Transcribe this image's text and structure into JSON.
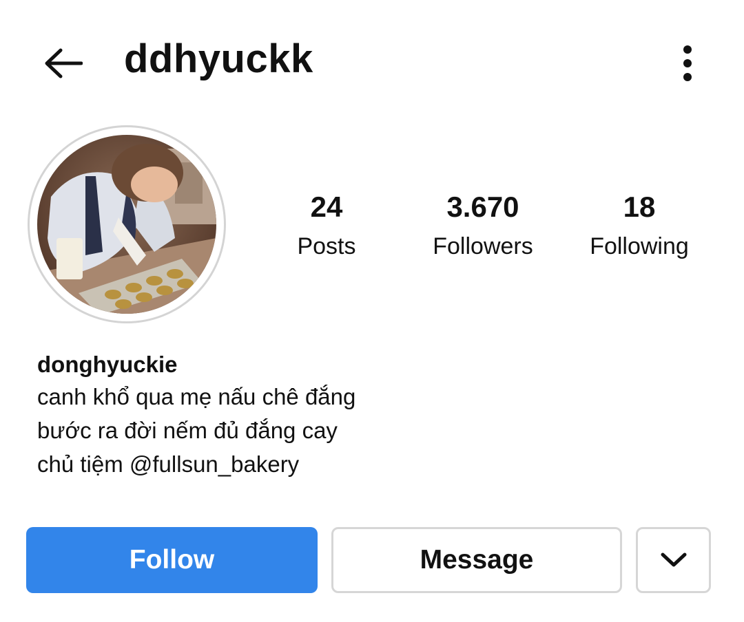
{
  "header": {
    "back_icon": "arrow-left-icon",
    "username": "ddhyuckk",
    "more_icon": "more-vertical-icon"
  },
  "profile": {
    "avatar_description": "profile photo",
    "stats": [
      {
        "value": "24",
        "label": "Posts"
      },
      {
        "value": "3.670",
        "label": "Followers"
      },
      {
        "value": "18",
        "label": "Following"
      }
    ]
  },
  "bio": {
    "name": "donghyuckie",
    "lines": [
      "canh khổ qua mẹ nấu chê đắng",
      "bước ra đời nếm đủ đắng cay",
      "chủ tiệm @fullsun_bakery"
    ]
  },
  "actions": {
    "follow_label": "Follow",
    "message_label": "Message",
    "dropdown_icon": "chevron-down-icon"
  },
  "colors": {
    "follow_button": "#3285ea",
    "border": "#d6d6d6"
  }
}
